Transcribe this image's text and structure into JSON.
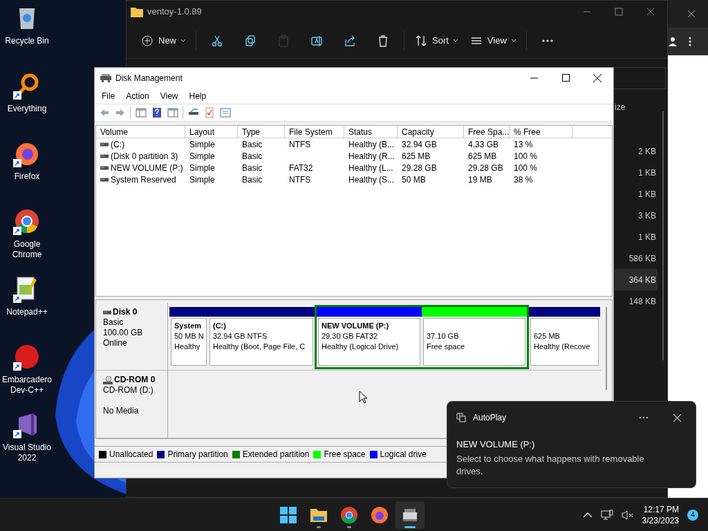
{
  "desktop_icons": [
    {
      "label": "Recycle Bin",
      "kind": "recycle"
    },
    {
      "label": "Everything",
      "kind": "everything"
    },
    {
      "label": "Firefox",
      "kind": "firefox"
    },
    {
      "label": "Google Chrome",
      "kind": "chrome"
    },
    {
      "label": "Notepad++",
      "kind": "notepad"
    },
    {
      "label": "Embarcadero Dev-C++",
      "kind": "devcpp"
    },
    {
      "label": "Visual Studio 2022",
      "kind": "vs"
    }
  ],
  "explorer": {
    "title": "ventoy-1.0.89",
    "toolbar": [
      {
        "kind": "new",
        "label": "New",
        "disabled": false
      },
      {
        "kind": "cut",
        "disabled": false
      },
      {
        "kind": "copy",
        "disabled": false
      },
      {
        "kind": "paste",
        "disabled": true
      },
      {
        "kind": "rename",
        "disabled": false
      },
      {
        "kind": "share",
        "disabled": false
      },
      {
        "kind": "delete",
        "disabled": false
      },
      {
        "kind": "sort",
        "label": "Sort",
        "disabled": false
      },
      {
        "kind": "view",
        "label": "View",
        "disabled": false
      },
      {
        "kind": "more",
        "disabled": false
      }
    ],
    "size_header": "ize",
    "sizes": [
      {
        "text": "2 KB",
        "selected": false
      },
      {
        "text": "1 KB",
        "selected": false
      },
      {
        "text": "1 KB",
        "selected": false
      },
      {
        "text": "3 KB",
        "selected": false
      },
      {
        "text": "1 KB",
        "selected": false
      },
      {
        "text": "586 KB",
        "selected": false
      },
      {
        "text": "364 KB",
        "selected": true
      },
      {
        "text": "148 KB",
        "selected": false
      }
    ]
  },
  "disk_management": {
    "title": "Disk Management",
    "menu": [
      "File",
      "Action",
      "View",
      "Help"
    ],
    "columns": [
      "Volume",
      "Layout",
      "Type",
      "File System",
      "Status",
      "Capacity",
      "Free Spa...",
      "% Free"
    ],
    "rows": [
      [
        "(C:)",
        "Simple",
        "Basic",
        "NTFS",
        "Healthy (B...",
        "32.94 GB",
        "4.33 GB",
        "13 %"
      ],
      [
        "(Disk 0 partition 3)",
        "Simple",
        "Basic",
        "",
        "Healthy (R...",
        "625 MB",
        "625 MB",
        "100 %"
      ],
      [
        "NEW VOLUME (P:)",
        "Simple",
        "Basic",
        "FAT32",
        "Healthy (L...",
        "29.28 GB",
        "29.28 GB",
        "100 %"
      ],
      [
        "System Reserved",
        "Simple",
        "Basic",
        "NTFS",
        "Healthy (S...",
        "50 MB",
        "19 MB",
        "38 %"
      ]
    ],
    "disks": [
      {
        "kind": "disk",
        "name": "Disk 0",
        "lines": [
          "Basic",
          "100.00 GB",
          "Online"
        ],
        "partitions": [
          {
            "kind": "primary",
            "name": "System",
            "size": "50 MB N",
            "status": "Healthy"
          },
          {
            "kind": "primary",
            "name": "(C:)",
            "size": "32.94 GB NTFS",
            "status": "Healthy (Boot, Page File, C"
          },
          {
            "kind": "extended",
            "children": [
              {
                "kind": "logical",
                "name": "NEW VOLUME  (P:)",
                "size": "29.30 GB FAT32",
                "status": "Healthy (Logical Drive)"
              },
              {
                "kind": "free",
                "size": "37.10 GB",
                "status": "Free space"
              }
            ]
          },
          {
            "kind": "primary",
            "size": "625 MB",
            "status": "Healthy (Recove"
          }
        ]
      },
      {
        "kind": "cdrom",
        "name": "CD-ROM 0",
        "lines": [
          "CD-ROM (D:)",
          "No Media"
        ]
      }
    ],
    "legend": [
      {
        "label": "Unallocated",
        "color": "#000000"
      },
      {
        "label": "Primary partition",
        "color": "#000080"
      },
      {
        "label": "Extended partition",
        "color": "#008000"
      },
      {
        "label": "Free space",
        "color": "#00ff00"
      },
      {
        "label": "Logical drive",
        "color": "#0000ff"
      }
    ]
  },
  "notification": {
    "app": "AutoPlay",
    "title": "NEW VOLUME (P:)",
    "body": "Select to choose what happens with removable drives."
  },
  "taskbar": {
    "apps": [
      {
        "kind": "start",
        "running": false,
        "selected": false
      },
      {
        "kind": "explorer",
        "running": true,
        "selected": false
      },
      {
        "kind": "chrome",
        "running": true,
        "selected": false
      },
      {
        "kind": "firefox",
        "running": false,
        "selected": false
      },
      {
        "kind": "diskmgmt",
        "running": true,
        "selected": true
      }
    ],
    "time": "12:17 PM",
    "date": "3/23/2023",
    "badge": "4"
  }
}
